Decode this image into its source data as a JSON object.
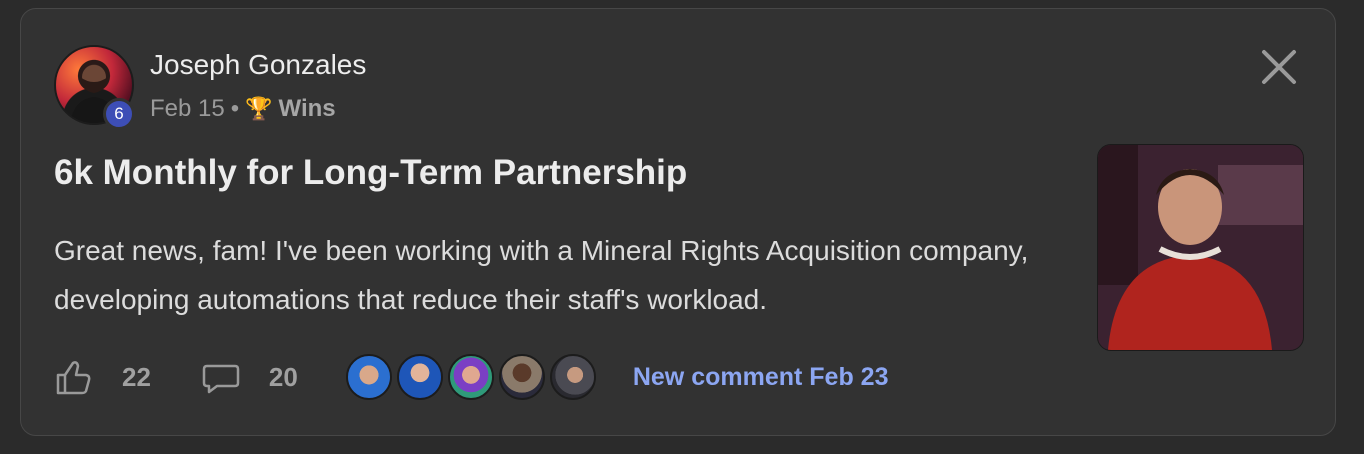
{
  "post": {
    "author": "Joseph Gonzales",
    "level": "6",
    "date": "Feb 15",
    "separator": "•",
    "category_icon": "trophy-icon",
    "category": "Wins",
    "title": "6k Monthly for Long-Term Partnership",
    "body": "Great news, fam! I've been working with a Mineral Rights Acquisition company, developing automations that reduce their staff's workload."
  },
  "footer": {
    "likes": "22",
    "comments": "20",
    "new_comment": "New comment Feb 23"
  },
  "colors": {
    "card_background": "#323232",
    "page_background": "#2b2b2b",
    "level_badge": "#3d4eb6",
    "link": "#8ca6f2"
  }
}
